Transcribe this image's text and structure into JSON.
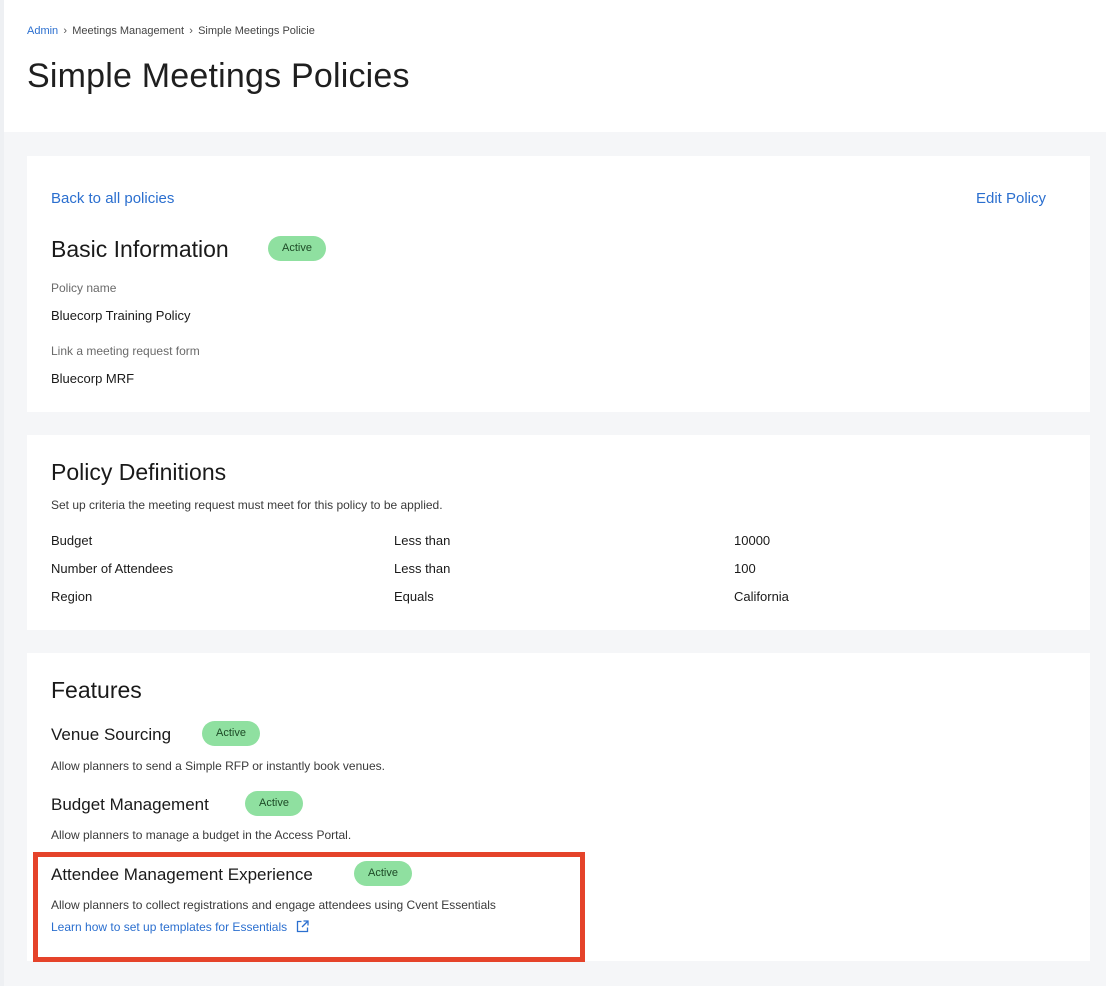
{
  "breadcrumb": {
    "items": [
      {
        "label": "Admin"
      },
      {
        "label": "Meetings Management"
      },
      {
        "label": "Simple Meetings Policie"
      }
    ]
  },
  "page": {
    "title": "Simple Meetings Policies"
  },
  "basic_info": {
    "back_link": "Back to all policies",
    "edit_link": "Edit Policy",
    "title": "Basic Information",
    "status": "Active",
    "policy_name_label": "Policy name",
    "policy_name_value": "Bluecorp Training Policy",
    "form_label": "Link a meeting request form",
    "form_value": "Bluecorp MRF"
  },
  "policy_definitions": {
    "title": "Policy Definitions",
    "description": "Set up criteria the meeting request must meet for this policy to be applied.",
    "rows": [
      {
        "criterion": "Budget",
        "operator": "Less than",
        "value": "10000"
      },
      {
        "criterion": "Number of Attendees",
        "operator": "Less than",
        "value": "100"
      },
      {
        "criterion": "Region",
        "operator": "Equals",
        "value": "California"
      }
    ]
  },
  "features": {
    "title": "Features",
    "items": [
      {
        "name": "Venue Sourcing",
        "status": "Active",
        "description": "Allow planners to send a Simple RFP or instantly book venues."
      },
      {
        "name": "Budget Management",
        "status": "Active",
        "description": "Allow planners to manage a budget in the Access Portal."
      },
      {
        "name": "Attendee Management Experience",
        "status": "Active",
        "description": "Allow planners to collect registrations and engage attendees using Cvent Essentials",
        "link": "Learn how to set up templates for Essentials",
        "link_icon": "external-link-icon"
      }
    ]
  },
  "colors": {
    "link": "#2b6fcf",
    "badge_bg": "#8fe0a0",
    "highlight": "#e5432a",
    "content_bg": "#f5f6f8"
  }
}
